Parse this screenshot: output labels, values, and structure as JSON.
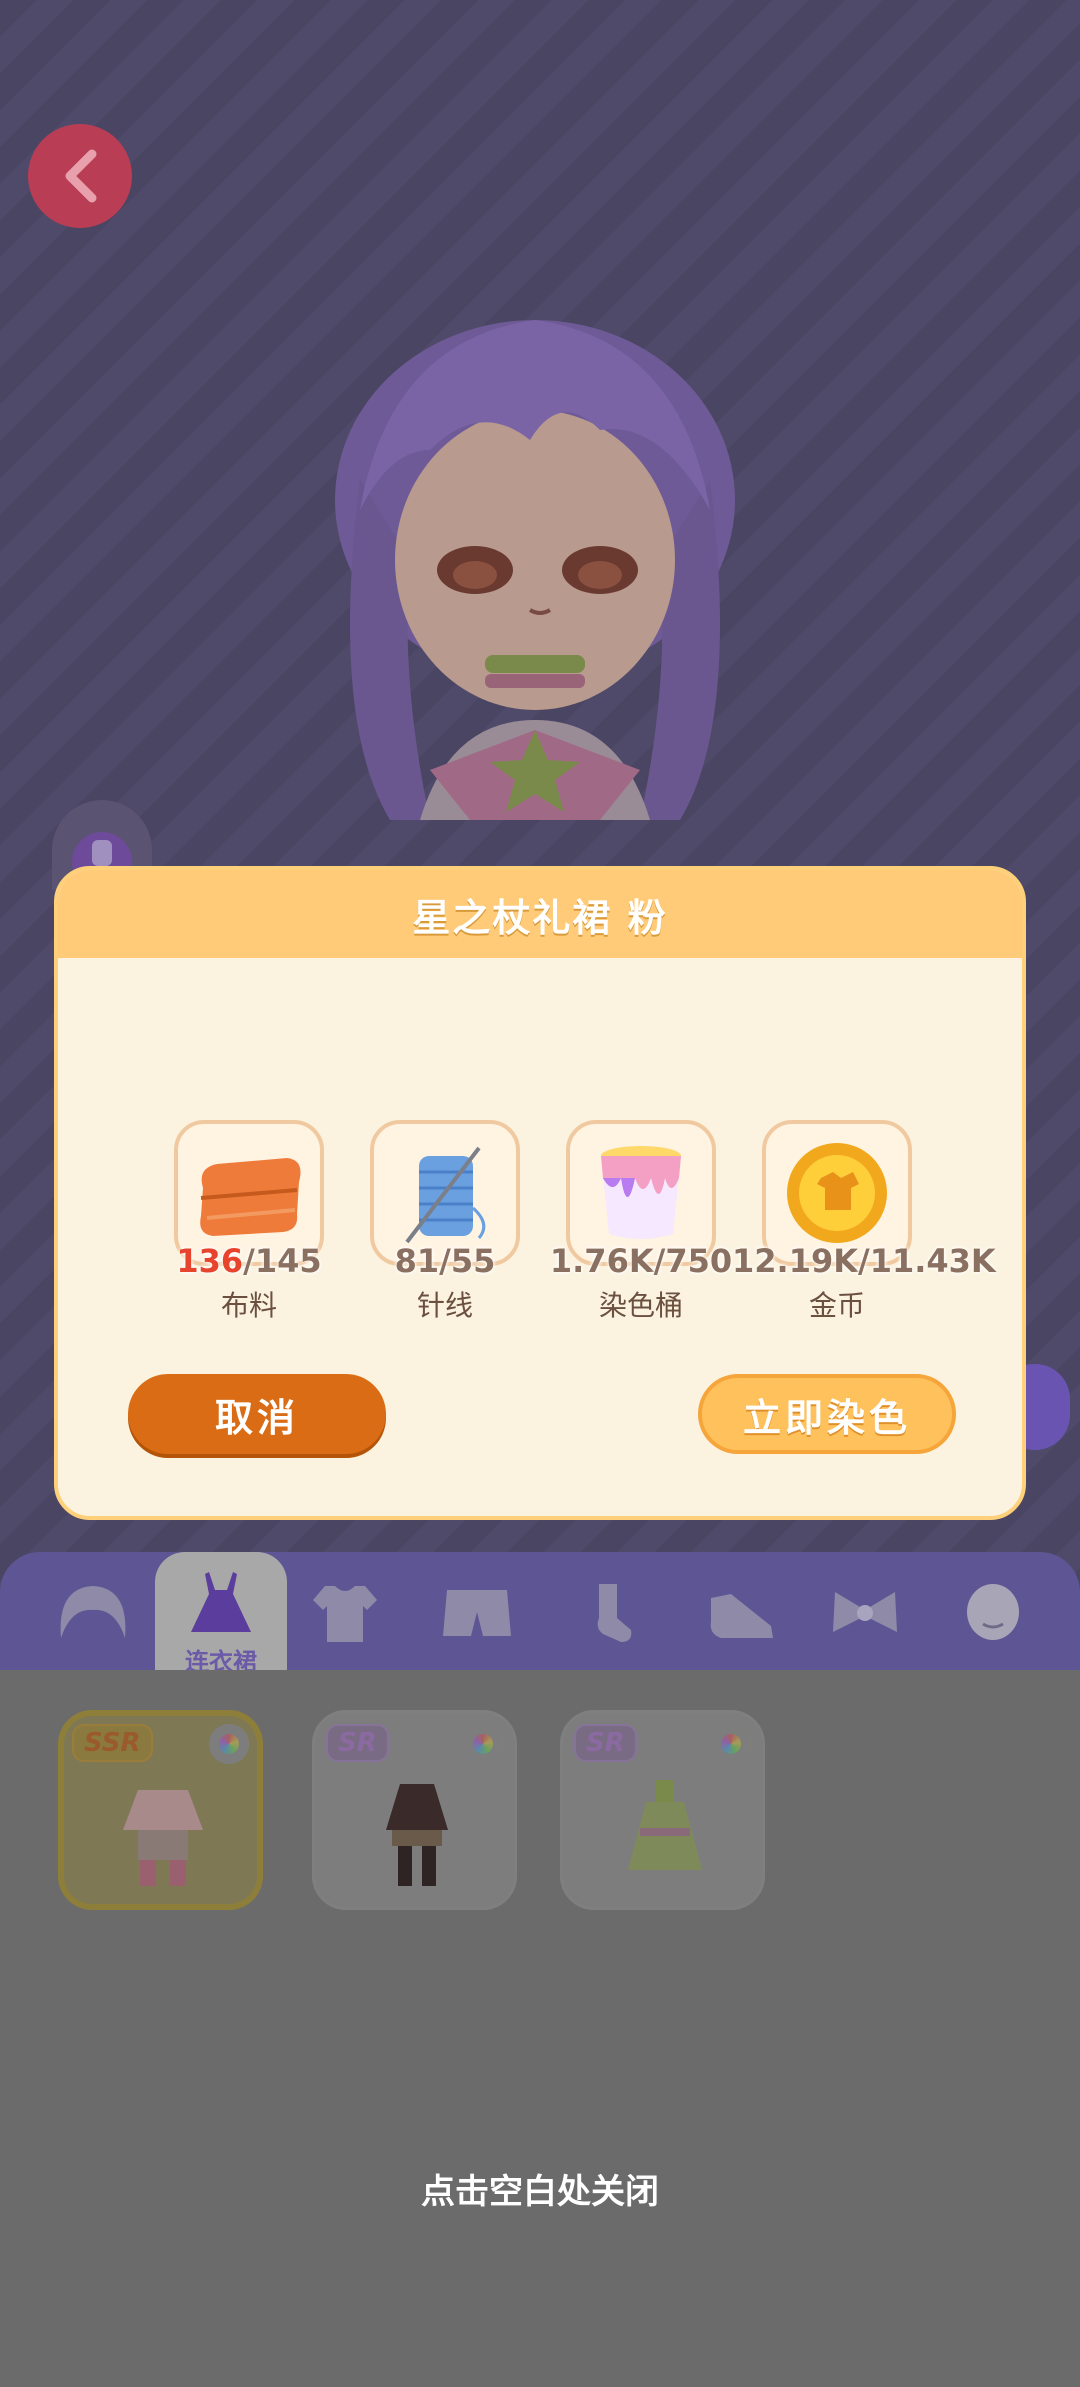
{
  "navigation": {
    "back_icon": "chevron-left-icon"
  },
  "modal": {
    "title": "星之杖礼裙 粉",
    "materials": [
      {
        "icon": "fabric-icon",
        "have": "136",
        "have_insufficient": true,
        "sep_need": "/145",
        "name": "布料"
      },
      {
        "icon": "needle-thread-icon",
        "have": "81",
        "have_insufficient": false,
        "sep_need": "/55",
        "name": "针线"
      },
      {
        "icon": "dye-bucket-icon",
        "have": "1.76K",
        "have_insufficient": false,
        "sep_need": "/750",
        "name": "染色桶"
      },
      {
        "icon": "gold-coin-icon",
        "have": "12.19K",
        "have_insufficient": false,
        "sep_need": "/11.43K",
        "name": "金币"
      }
    ],
    "cancel_label": "取消",
    "confirm_label": "立即染色"
  },
  "tabs": {
    "active_label": "连衣裙",
    "items": [
      "hair-icon",
      "dress-icon",
      "shirt-icon",
      "shorts-icon",
      "sock-icon",
      "shoe-icon",
      "bow-icon",
      "face-icon"
    ]
  },
  "items": [
    {
      "rarity": "SSR",
      "selected": true
    },
    {
      "rarity": "SR",
      "selected": false
    },
    {
      "rarity": "SR",
      "selected": false
    }
  ],
  "close_hint": "点击空白处关闭"
}
